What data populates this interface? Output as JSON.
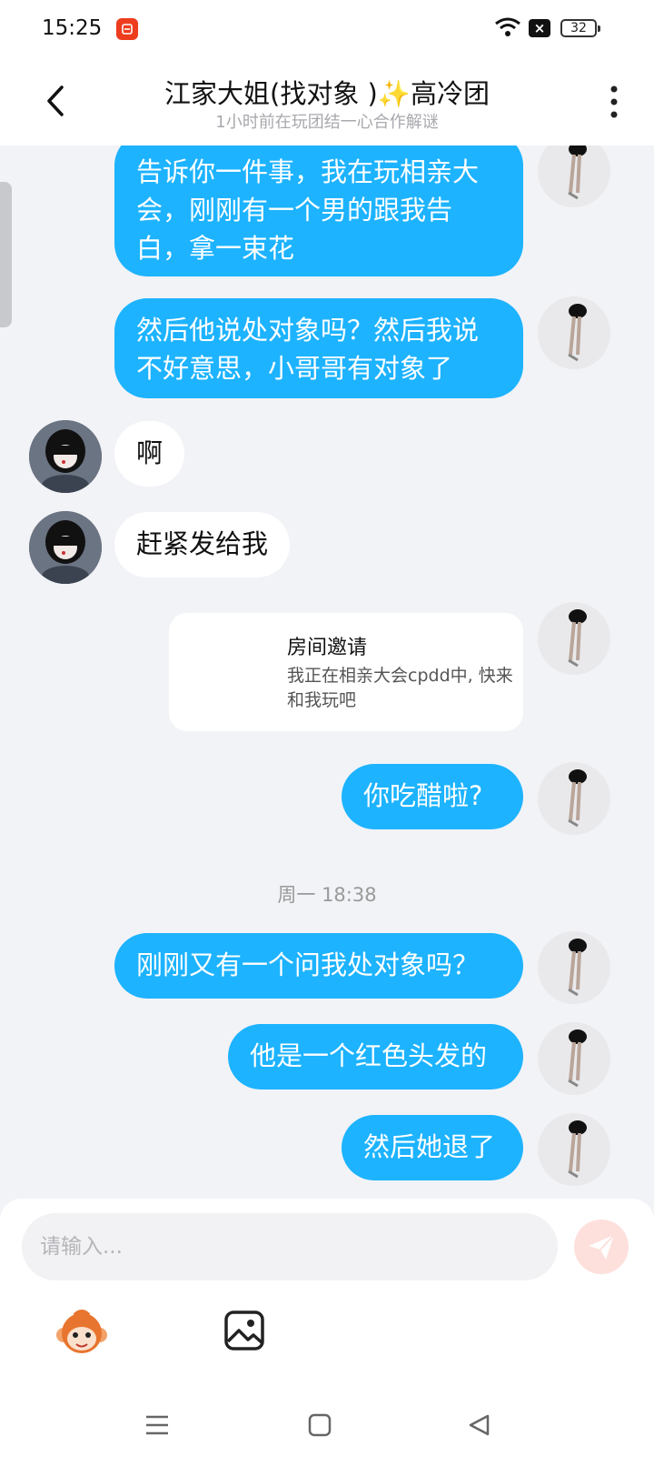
{
  "status_bar": {
    "time": "15:25",
    "battery": "32"
  },
  "header": {
    "title": "江家大姐(找对象 )✨高冷团",
    "subtitle": "1小时前在玩团结一心合作解谜"
  },
  "messages": [
    {
      "side": "self",
      "text_lines": [
        "告诉你一件事，我在玩相亲大",
        "会，刚刚有一个男的跟我告",
        "白，拿一束花"
      ]
    },
    {
      "side": "self",
      "text_lines": [
        "然后他说处对象吗？然后我说",
        "不好意思，小哥哥有对象了"
      ]
    },
    {
      "side": "other",
      "text": "啊"
    },
    {
      "side": "other",
      "text": "赶紧发给我"
    },
    {
      "side": "self",
      "type": "room-invite",
      "title": "房间邀请",
      "desc": "我正在相亲大会cpdd中, 快来和我玩吧"
    },
    {
      "side": "self",
      "text": "你吃醋啦?"
    },
    {
      "type": "time",
      "text": "周一 18:38"
    },
    {
      "side": "self",
      "text": "刚刚又有一个问我处对象吗？"
    },
    {
      "side": "self",
      "text": "他是一个红色头发的"
    },
    {
      "side": "self",
      "text": "然后她退了"
    }
  ],
  "input": {
    "placeholder": "请输入..."
  },
  "icons": {
    "back": "chevron-left-icon",
    "more": "more-vertical-icon",
    "send": "paper-plane-icon",
    "emoji": "monkey-emoji-icon",
    "image": "image-icon",
    "nav_menu": "menu-icon",
    "nav_home": "square-home-icon",
    "nav_back": "triangle-back-icon"
  },
  "colors": {
    "outgoing_bubble": "#1db3ff",
    "incoming_bubble": "#ffffff",
    "background": "#f2f3f7",
    "send_button": "#fde0dc"
  }
}
